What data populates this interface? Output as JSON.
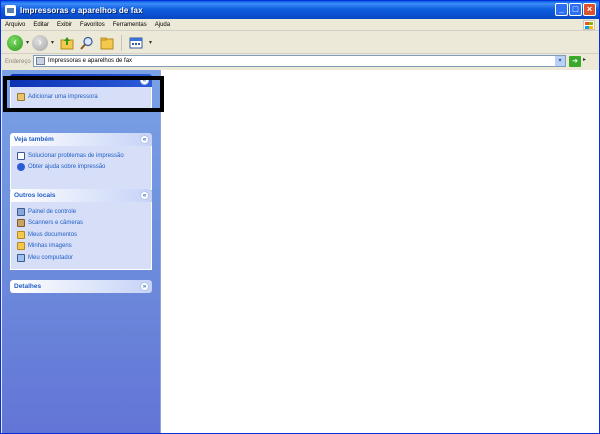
{
  "window": {
    "title": "Impressoras e aparelhos de fax"
  },
  "menu": [
    "Arquivo",
    "Editar",
    "Exibir",
    "Favoritos",
    "Ferramentas",
    "Ajuda"
  ],
  "toolbar": {
    "icons": [
      "back-icon",
      "forward-icon",
      "up-folder-icon",
      "search-icon",
      "folders-icon",
      "views-icon"
    ]
  },
  "address": {
    "label": "Endereço",
    "value": "Impressoras e aparelhos de fax"
  },
  "tasks_pane": {
    "printer_tasks": {
      "items": [
        {
          "label": "Adicionar uma impressora",
          "icon": "add-printer-icon"
        }
      ]
    },
    "see_also": {
      "title": "Veja também",
      "items": [
        {
          "label": "Solucionar problemas de impressão",
          "icon": "help-icon"
        },
        {
          "label": "Obter ajuda sobre impressão",
          "icon": "help-circle-icon"
        }
      ]
    },
    "other_places": {
      "title": "Outros locais",
      "items": [
        {
          "label": "Painel de controle",
          "icon": "control-panel-icon"
        },
        {
          "label": "Scanners e câmeras",
          "icon": "scanner-icon"
        },
        {
          "label": "Meus documentos",
          "icon": "documents-folder-icon"
        },
        {
          "label": "Minhas imagens",
          "icon": "pictures-folder-icon"
        },
        {
          "label": "Meu computador",
          "icon": "computer-icon"
        }
      ]
    },
    "details": {
      "title": "Detalhes"
    }
  }
}
